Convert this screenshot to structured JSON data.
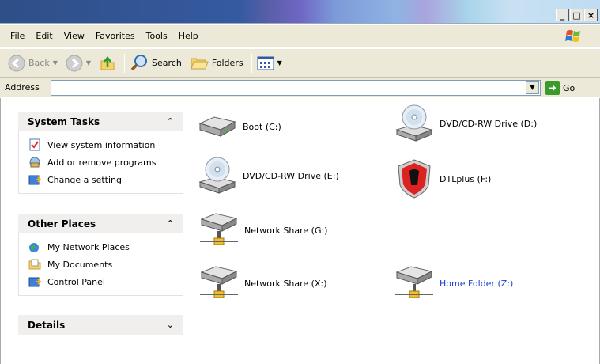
{
  "window": {
    "minimize": "_",
    "maximize": "□",
    "close": "×"
  },
  "menu": [
    {
      "label": "File",
      "accel": "F"
    },
    {
      "label": "Edit",
      "accel": "E"
    },
    {
      "label": "View",
      "accel": "V"
    },
    {
      "label": "Favorites",
      "accel": "a"
    },
    {
      "label": "Tools",
      "accel": "T"
    },
    {
      "label": "Help",
      "accel": "H"
    }
  ],
  "toolbar": {
    "back": "Back",
    "search": "Search",
    "folders": "Folders"
  },
  "address": {
    "label": "Address",
    "value": "",
    "go": "Go"
  },
  "system_tasks": {
    "title": "System Tasks",
    "items": [
      "View system information",
      "Add or remove programs",
      "Change a setting"
    ]
  },
  "other_places": {
    "title": "Other Places",
    "items": [
      "My Network Places",
      "My Documents",
      "Control Panel"
    ]
  },
  "details": {
    "title": "Details"
  },
  "drives": [
    {
      "label": "Boot (C:)",
      "icon": "hard-disk-icon"
    },
    {
      "label": "DVD/CD-RW Drive (D:)",
      "icon": "cd-drive-icon"
    },
    {
      "label": "DVD/CD-RW Drive (E:)",
      "icon": "cd-drive-icon"
    },
    {
      "label": "DTLplus (F:)",
      "icon": "kingston-usb-icon"
    },
    {
      "label": "Network Share (G:)",
      "icon": "network-drive-icon"
    },
    {
      "label": "Network Share (X:)",
      "icon": "network-drive-icon"
    },
    {
      "label": "Home Folder (Z:)",
      "icon": "network-drive-icon"
    }
  ],
  "colors": {
    "link_highlight": "#1a3cd6"
  }
}
